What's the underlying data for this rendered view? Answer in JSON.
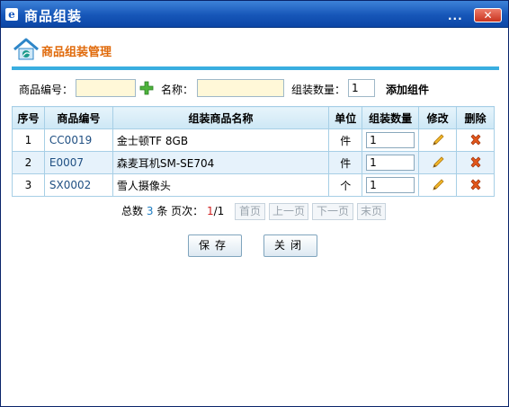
{
  "window": {
    "title": "商品组装",
    "title_icon": "ie-icon",
    "dots": "...",
    "close_label": "✕"
  },
  "section": {
    "title": "商品组装管理",
    "icon": "home-icon",
    "accent_color": "#e06a0b",
    "rule_color": "#39aee0"
  },
  "form": {
    "code_label": "商品编号：",
    "code_value": "",
    "name_label": "名称：",
    "name_value": "",
    "qty_label": "组装数量：",
    "qty_value": "1",
    "add_label": "添加组件"
  },
  "table": {
    "headers": [
      "序号",
      "商品编号",
      "组装商品名称",
      "单位",
      "组装数量",
      "修改",
      "删除"
    ],
    "rows": [
      {
        "no": "1",
        "code": "CC0019",
        "name": "金士顿TF 8GB",
        "unit": "件",
        "qty": "1"
      },
      {
        "no": "2",
        "code": "E0007",
        "name": "森麦耳机SM-SE704",
        "unit": "件",
        "qty": "1"
      },
      {
        "no": "3",
        "code": "SX0002",
        "name": "雪人摄像头",
        "unit": "个",
        "qty": "1"
      }
    ]
  },
  "pager": {
    "total_prefix": "总数",
    "total": "3",
    "total_suffix": "条 页次：",
    "current": "1",
    "sep": "/",
    "pages": "1",
    "first": "首页",
    "prev": "上一页",
    "next": "下一页",
    "last": "末页"
  },
  "buttons": {
    "save": "保存",
    "close": "关闭"
  }
}
